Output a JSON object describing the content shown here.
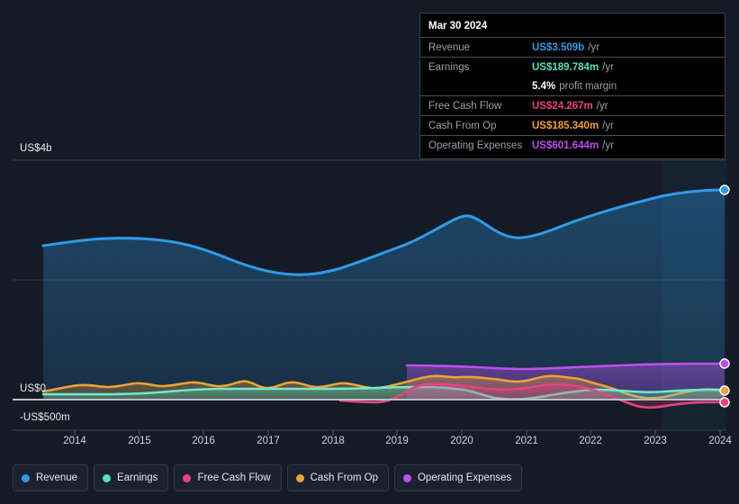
{
  "tooltip": {
    "date": "Mar 30 2024",
    "rows": [
      {
        "label": "Revenue",
        "value": "US$3.509b",
        "unit": "/yr",
        "color": "#2f9be8"
      },
      {
        "label": "Earnings",
        "value": "US$189.784m",
        "unit": "/yr",
        "color": "#4fe3c1"
      },
      {
        "label": "Free Cash Flow",
        "value": "US$24.267m",
        "unit": "/yr",
        "color": "#e8437f"
      },
      {
        "label": "Cash From Op",
        "value": "US$185.340m",
        "unit": "/yr",
        "color": "#eda234"
      },
      {
        "label": "Operating Expenses",
        "value": "US$601.644m",
        "unit": "/yr",
        "color": "#bf4ef0"
      }
    ],
    "margin_value": "5.4%",
    "margin_label": "profit margin"
  },
  "axis": {
    "y_top": "US$4b",
    "y_zero": "US$0",
    "y_neg": "-US$500m",
    "x_ticks": [
      "2014",
      "2015",
      "2016",
      "2017",
      "2018",
      "2019",
      "2020",
      "2021",
      "2022",
      "2023",
      "2024"
    ]
  },
  "legend": [
    {
      "label": "Revenue",
      "color": "#2f9be8"
    },
    {
      "label": "Earnings",
      "color": "#4fe3c1"
    },
    {
      "label": "Free Cash Flow",
      "color": "#e8437f"
    },
    {
      "label": "Cash From Op",
      "color": "#eda234"
    },
    {
      "label": "Operating Expenses",
      "color": "#bf4ef0"
    }
  ],
  "chart_data": {
    "type": "area",
    "title": "",
    "xlabel": "",
    "ylabel": "",
    "ylim": [
      -500000000,
      4000000000
    ],
    "y_ticks": [
      {
        "label": "US$4b",
        "value": 4000000000
      },
      {
        "label": "US$0",
        "value": 0
      },
      {
        "label": "-US$500m",
        "value": -500000000
      }
    ],
    "grid": true,
    "legend_position": "bottom-left",
    "x": [
      "2013.6",
      "2014",
      "2014.5",
      "2015",
      "2015.5",
      "2016",
      "2016.5",
      "2017",
      "2017.5",
      "2018",
      "2018.5",
      "2019",
      "2019.5",
      "2020",
      "2020.5",
      "2021",
      "2021.5",
      "2022",
      "2022.5",
      "2023",
      "2023.5",
      "2024.25"
    ],
    "series": [
      {
        "name": "Revenue",
        "color": "#2f9be8",
        "unit": "US$",
        "values": [
          2090,
          2180,
          2200,
          2185,
          2160,
          2090,
          2015,
          1985,
          1990,
          2045,
          2130,
          2230,
          2300,
          2420,
          2350,
          2310,
          2350,
          2420,
          2500,
          2620,
          2820,
          3509
        ]
      },
      {
        "name": "Earnings",
        "color": "#4fe3c1",
        "unit": "US$",
        "values": [
          96,
          93,
          92,
          94,
          108,
          112,
          112,
          112,
          112,
          110,
          108,
          105,
          100,
          55,
          30,
          45,
          70,
          95,
          95,
          88,
          110,
          189.784
        ]
      },
      {
        "name": "Free Cash Flow",
        "color": "#e8437f",
        "unit": "US$",
        "values": [
          null,
          null,
          null,
          null,
          null,
          null,
          null,
          null,
          null,
          -20,
          -30,
          -25,
          10,
          95,
          110,
          80,
          75,
          70,
          -10,
          -95,
          -60,
          24.267
        ]
      },
      {
        "name": "Cash From Op",
        "color": "#eda234",
        "unit": "US$",
        "values": [
          125,
          165,
          150,
          170,
          160,
          175,
          165,
          185,
          150,
          175,
          140,
          175,
          230,
          255,
          210,
          265,
          250,
          185,
          115,
          10,
          95,
          185.34
        ]
      },
      {
        "name": "Operating Expenses",
        "color": "#bf4ef0",
        "unit": "US$",
        "values": [
          null,
          null,
          null,
          null,
          null,
          null,
          null,
          null,
          null,
          null,
          null,
          530,
          525,
          510,
          515,
          520,
          525,
          530,
          535,
          545,
          565,
          601.644
        ]
      }
    ],
    "notes": "Revenue in US$ millions; other series in US$ millions. Operating Expenses and Free Cash Flow series begin partway through the period."
  }
}
